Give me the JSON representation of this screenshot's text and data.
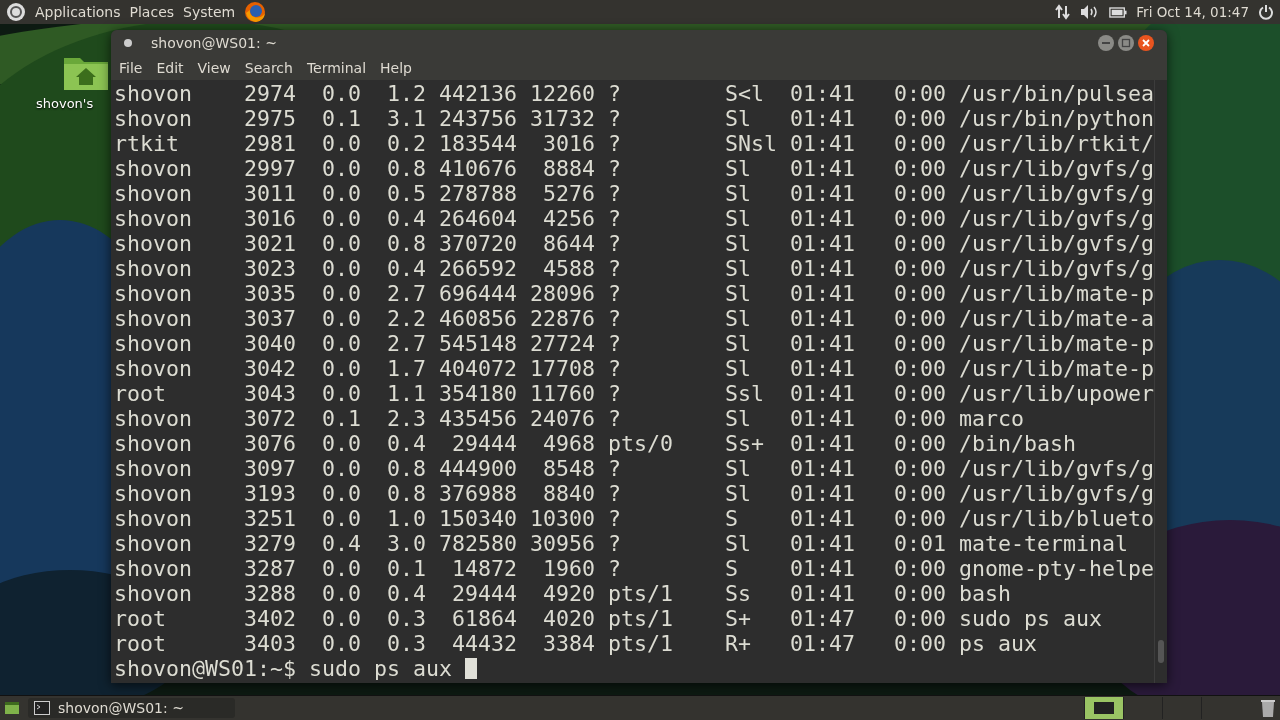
{
  "top_panel": {
    "menus": [
      "Applications",
      "Places",
      "System"
    ],
    "clock": "Fri Oct 14, 01:47"
  },
  "desktop": {
    "icons": [
      {
        "label": "shovon's"
      }
    ]
  },
  "window": {
    "title": "shovon@WS01: ~",
    "menu": [
      "File",
      "Edit",
      "View",
      "Search",
      "Terminal",
      "Help"
    ]
  },
  "terminal": {
    "rows": [
      {
        "user": "shovon",
        "pid": "2974",
        "cpu": "0.0",
        "mem": "1.2",
        "vsz": "442136",
        "rss": "12260",
        "tty": "?",
        "stat": "S<l",
        "start": "01:41",
        "time": "0:00",
        "command": "/usr/bin/pulsea"
      },
      {
        "user": "shovon",
        "pid": "2975",
        "cpu": "0.1",
        "mem": "3.1",
        "vsz": "243756",
        "rss": "31732",
        "tty": "?",
        "stat": "Sl",
        "start": "01:41",
        "time": "0:00",
        "command": "/usr/bin/python"
      },
      {
        "user": "rtkit",
        "pid": "2981",
        "cpu": "0.0",
        "mem": "0.2",
        "vsz": "183544",
        "rss": "3016",
        "tty": "?",
        "stat": "SNsl",
        "start": "01:41",
        "time": "0:00",
        "command": "/usr/lib/rtkit/"
      },
      {
        "user": "shovon",
        "pid": "2997",
        "cpu": "0.0",
        "mem": "0.8",
        "vsz": "410676",
        "rss": "8884",
        "tty": "?",
        "stat": "Sl",
        "start": "01:41",
        "time": "0:00",
        "command": "/usr/lib/gvfs/g"
      },
      {
        "user": "shovon",
        "pid": "3011",
        "cpu": "0.0",
        "mem": "0.5",
        "vsz": "278788",
        "rss": "5276",
        "tty": "?",
        "stat": "Sl",
        "start": "01:41",
        "time": "0:00",
        "command": "/usr/lib/gvfs/g"
      },
      {
        "user": "shovon",
        "pid": "3016",
        "cpu": "0.0",
        "mem": "0.4",
        "vsz": "264604",
        "rss": "4256",
        "tty": "?",
        "stat": "Sl",
        "start": "01:41",
        "time": "0:00",
        "command": "/usr/lib/gvfs/g"
      },
      {
        "user": "shovon",
        "pid": "3021",
        "cpu": "0.0",
        "mem": "0.8",
        "vsz": "370720",
        "rss": "8644",
        "tty": "?",
        "stat": "Sl",
        "start": "01:41",
        "time": "0:00",
        "command": "/usr/lib/gvfs/g"
      },
      {
        "user": "shovon",
        "pid": "3023",
        "cpu": "0.0",
        "mem": "0.4",
        "vsz": "266592",
        "rss": "4588",
        "tty": "?",
        "stat": "Sl",
        "start": "01:41",
        "time": "0:00",
        "command": "/usr/lib/gvfs/g"
      },
      {
        "user": "shovon",
        "pid": "3035",
        "cpu": "0.0",
        "mem": "2.7",
        "vsz": "696444",
        "rss": "28096",
        "tty": "?",
        "stat": "Sl",
        "start": "01:41",
        "time": "0:00",
        "command": "/usr/lib/mate-p"
      },
      {
        "user": "shovon",
        "pid": "3037",
        "cpu": "0.0",
        "mem": "2.2",
        "vsz": "460856",
        "rss": "22876",
        "tty": "?",
        "stat": "Sl",
        "start": "01:41",
        "time": "0:00",
        "command": "/usr/lib/mate-a"
      },
      {
        "user": "shovon",
        "pid": "3040",
        "cpu": "0.0",
        "mem": "2.7",
        "vsz": "545148",
        "rss": "27724",
        "tty": "?",
        "stat": "Sl",
        "start": "01:41",
        "time": "0:00",
        "command": "/usr/lib/mate-p"
      },
      {
        "user": "shovon",
        "pid": "3042",
        "cpu": "0.0",
        "mem": "1.7",
        "vsz": "404072",
        "rss": "17708",
        "tty": "?",
        "stat": "Sl",
        "start": "01:41",
        "time": "0:00",
        "command": "/usr/lib/mate-p"
      },
      {
        "user": "root",
        "pid": "3043",
        "cpu": "0.0",
        "mem": "1.1",
        "vsz": "354180",
        "rss": "11760",
        "tty": "?",
        "stat": "Ssl",
        "start": "01:41",
        "time": "0:00",
        "command": "/usr/lib/upower"
      },
      {
        "user": "shovon",
        "pid": "3072",
        "cpu": "0.1",
        "mem": "2.3",
        "vsz": "435456",
        "rss": "24076",
        "tty": "?",
        "stat": "Sl",
        "start": "01:41",
        "time": "0:00",
        "command": "marco"
      },
      {
        "user": "shovon",
        "pid": "3076",
        "cpu": "0.0",
        "mem": "0.4",
        "vsz": "29444",
        "rss": "4968",
        "tty": "pts/0",
        "stat": "Ss+",
        "start": "01:41",
        "time": "0:00",
        "command": "/bin/bash"
      },
      {
        "user": "shovon",
        "pid": "3097",
        "cpu": "0.0",
        "mem": "0.8",
        "vsz": "444900",
        "rss": "8548",
        "tty": "?",
        "stat": "Sl",
        "start": "01:41",
        "time": "0:00",
        "command": "/usr/lib/gvfs/g"
      },
      {
        "user": "shovon",
        "pid": "3193",
        "cpu": "0.0",
        "mem": "0.8",
        "vsz": "376988",
        "rss": "8840",
        "tty": "?",
        "stat": "Sl",
        "start": "01:41",
        "time": "0:00",
        "command": "/usr/lib/gvfs/g"
      },
      {
        "user": "shovon",
        "pid": "3251",
        "cpu": "0.0",
        "mem": "1.0",
        "vsz": "150340",
        "rss": "10300",
        "tty": "?",
        "stat": "S",
        "start": "01:41",
        "time": "0:00",
        "command": "/usr/lib/blueto"
      },
      {
        "user": "shovon",
        "pid": "3279",
        "cpu": "0.4",
        "mem": "3.0",
        "vsz": "782580",
        "rss": "30956",
        "tty": "?",
        "stat": "Sl",
        "start": "01:41",
        "time": "0:01",
        "command": "mate-terminal"
      },
      {
        "user": "shovon",
        "pid": "3287",
        "cpu": "0.0",
        "mem": "0.1",
        "vsz": "14872",
        "rss": "1960",
        "tty": "?",
        "stat": "S",
        "start": "01:41",
        "time": "0:00",
        "command": "gnome-pty-helpe"
      },
      {
        "user": "shovon",
        "pid": "3288",
        "cpu": "0.0",
        "mem": "0.4",
        "vsz": "29444",
        "rss": "4920",
        "tty": "pts/1",
        "stat": "Ss",
        "start": "01:41",
        "time": "0:00",
        "command": "bash"
      },
      {
        "user": "root",
        "pid": "3402",
        "cpu": "0.0",
        "mem": "0.3",
        "vsz": "61864",
        "rss": "4020",
        "tty": "pts/1",
        "stat": "S+",
        "start": "01:47",
        "time": "0:00",
        "command": "sudo ps aux"
      },
      {
        "user": "root",
        "pid": "3403",
        "cpu": "0.0",
        "mem": "0.3",
        "vsz": "44432",
        "rss": "3384",
        "tty": "pts/1",
        "stat": "R+",
        "start": "01:47",
        "time": "0:00",
        "command": "ps aux"
      }
    ],
    "prompt": "shovon@WS01:~$ sudo ps aux "
  },
  "taskbar": {
    "tasks": [
      {
        "label": "shovon@WS01: ~"
      }
    ]
  }
}
